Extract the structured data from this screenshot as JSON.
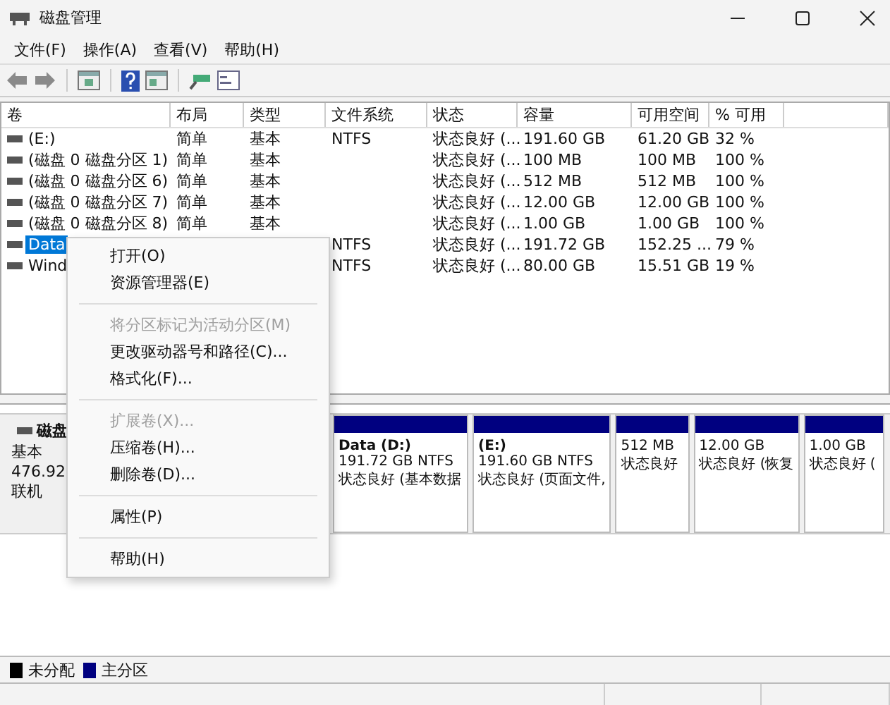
{
  "window": {
    "title": "磁盘管理"
  },
  "menu": [
    "文件(F)",
    "操作(A)",
    "查看(V)",
    "帮助(H)"
  ],
  "table": {
    "columns": [
      "卷",
      "布局",
      "类型",
      "文件系统",
      "状态",
      "容量",
      "可用空间",
      "% 可用"
    ],
    "rows": [
      {
        "cells": [
          "(E:)",
          "简单",
          "基本",
          "NTFS",
          "状态良好 (...",
          "191.60 GB",
          "61.20 GB",
          "32 %"
        ],
        "selected": false
      },
      {
        "cells": [
          "(磁盘 0 磁盘分区 1)",
          "简单",
          "基本",
          null,
          "状态良好 (...",
          "100 MB",
          "100 MB",
          "100 %"
        ],
        "selected": false
      },
      {
        "cells": [
          "(磁盘 0 磁盘分区 6)",
          "简单",
          "基本",
          null,
          "状态良好 (...",
          "512 MB",
          "512 MB",
          "100 %"
        ],
        "selected": false
      },
      {
        "cells": [
          "(磁盘 0 磁盘分区 7)",
          "简单",
          "基本",
          null,
          "状态良好 (...",
          "12.00 GB",
          "12.00 GB",
          "100 %"
        ],
        "selected": false
      },
      {
        "cells": [
          "(磁盘 0 磁盘分区 8)",
          "简单",
          "基本",
          null,
          "状态良好 (...",
          "1.00 GB",
          "1.00 GB",
          "100 %"
        ],
        "selected": false
      },
      {
        "cells": [
          "Data",
          null,
          null,
          "NTFS",
          "状态良好 (...",
          "191.72 GB",
          "152.25 ...",
          "79 %"
        ],
        "selected": true
      },
      {
        "cells": [
          "Wind",
          null,
          null,
          "NTFS",
          "状态良好 (...",
          "80.00 GB",
          "15.51 GB",
          "19 %"
        ],
        "selected": false
      }
    ]
  },
  "context_menu": {
    "groups": [
      [
        {
          "label": "打开(O)",
          "disabled": false
        },
        {
          "label": "资源管理器(E)",
          "disabled": false
        }
      ],
      [
        {
          "label": "将分区标记为活动分区(M)",
          "disabled": true
        },
        {
          "label": "更改驱动器号和路径(C)...",
          "disabled": false
        },
        {
          "label": "格式化(F)...",
          "disabled": false
        }
      ],
      [
        {
          "label": "扩展卷(X)...",
          "disabled": true
        },
        {
          "label": "压缩卷(H)...",
          "disabled": false
        },
        {
          "label": "删除卷(D)...",
          "disabled": false
        }
      ],
      [
        {
          "label": "属性(P)",
          "disabled": false
        }
      ],
      [
        {
          "label": "帮助(H)",
          "disabled": false
        }
      ]
    ]
  },
  "disk": {
    "name": "磁盘",
    "lines": [
      "基本",
      "476.92",
      "联机"
    ],
    "partitions": [
      {
        "title": "Data (D:)",
        "lines": [
          "191.72 GB NTFS",
          "状态良好 (基本数据"
        ]
      },
      {
        "title": "(E:)",
        "lines": [
          "191.60 GB NTFS",
          "状态良好 (页面文件,"
        ]
      },
      {
        "lines": [
          "512 MB",
          "状态良好"
        ]
      },
      {
        "lines": [
          "12.00 GB",
          "状态良好 (恢复"
        ]
      },
      {
        "lines": [
          "1.00 GB",
          "状态良好 ("
        ]
      }
    ]
  },
  "legend": [
    {
      "label": "未分配",
      "color": "#000000"
    },
    {
      "label": "主分区",
      "color": "#000080"
    }
  ]
}
